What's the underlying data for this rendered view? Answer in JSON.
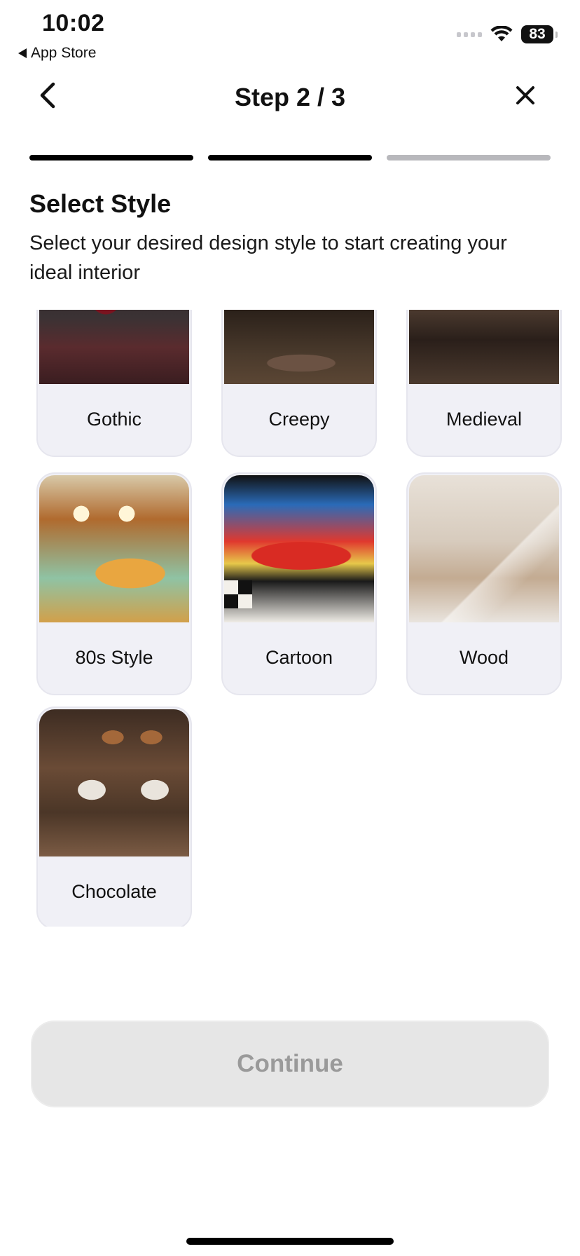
{
  "status_bar": {
    "time": "10:02",
    "back_app": "App Store",
    "battery": "83"
  },
  "nav": {
    "title": "Step 2 / 3",
    "back_icon": "chevron-left-icon",
    "close_icon": "close-icon"
  },
  "progress": {
    "current_step": 2,
    "total_steps": 3
  },
  "content": {
    "heading": "Select Style",
    "subtitle": "Select your desired design style to start creating your ideal interior"
  },
  "styles": [
    {
      "label": "Gothic"
    },
    {
      "label": "Creepy"
    },
    {
      "label": "Medieval"
    },
    {
      "label": "80s Style"
    },
    {
      "label": "Cartoon"
    },
    {
      "label": "Wood"
    },
    {
      "label": "Chocolate"
    }
  ],
  "footer": {
    "continue_label": "Continue"
  },
  "colors": {
    "accent": "#000000",
    "card_bg": "#f0f0f6",
    "disabled_button": "#e6e6e6",
    "disabled_text": "#9a9a9a"
  }
}
